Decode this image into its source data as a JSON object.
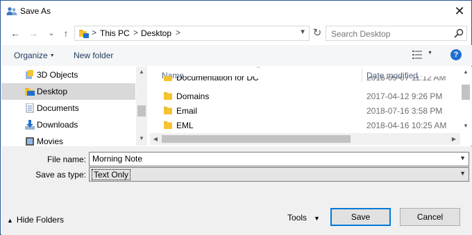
{
  "window": {
    "title": "Save As",
    "close_glyph": "✕"
  },
  "nav": {
    "back_glyph": "←",
    "forward_glyph": "→",
    "recent_glyph": "⌄",
    "up_glyph": "↑"
  },
  "address": {
    "crumbs": [
      "This PC",
      "Desktop"
    ],
    "separator": ">",
    "refresh_glyph": "↻"
  },
  "search": {
    "placeholder": "Search Desktop"
  },
  "toolbar": {
    "organize": "Organize",
    "new_folder": "New folder",
    "help": "?"
  },
  "nav_pane": {
    "items": [
      {
        "label": "3D Objects",
        "icon": "3d-objects-icon"
      },
      {
        "label": "Desktop",
        "icon": "desktop-folder-icon",
        "selected": true
      },
      {
        "label": "Documents",
        "icon": "documents-icon"
      },
      {
        "label": "Downloads",
        "icon": "downloads-icon"
      },
      {
        "label": "Movies",
        "icon": "movies-icon"
      }
    ]
  },
  "file_list": {
    "columns": {
      "name": "Name",
      "date": "Date modified"
    },
    "rows": [
      {
        "name": "Documentation for DC",
        "date": "2018-09-07 11:12 AM"
      },
      {
        "name": "Domains",
        "date": "2017-04-12 9:26 PM"
      },
      {
        "name": "Email",
        "date": "2018-07-16 3:58 PM"
      },
      {
        "name": "EML",
        "date": "2018-04-16 10:25 AM"
      }
    ]
  },
  "form": {
    "file_name_label": "File name:",
    "file_name_value": "Morning Note",
    "save_type_label": "Save as type:",
    "save_type_value": "Text Only"
  },
  "footer": {
    "hide_folders": "Hide Folders",
    "tools": "Tools",
    "save": "Save",
    "cancel": "Cancel"
  },
  "colors": {
    "accent": "#0078d7",
    "folder": "#f4c430",
    "selected_nav": "#d9d9d9"
  }
}
